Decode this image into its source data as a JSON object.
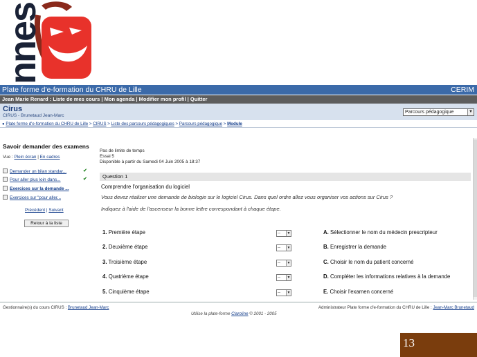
{
  "logo": {
    "text": "nnes"
  },
  "header": {
    "title": "Plate forme d'e-formation du CHRU de Lille",
    "brand": "CERIM"
  },
  "userbar": {
    "user": "Jean Marie Renard",
    "sep": " : ",
    "links": [
      "Liste de mes cours",
      "Mon agenda",
      "Modifier mon profil",
      "Quitter"
    ]
  },
  "course": {
    "title": "Cirus",
    "subtitle": "CIRUS - Brunetaud Jean-Marc",
    "select_value": "Parcours pédagogique"
  },
  "breadcrumb": {
    "items": [
      "Plate forme d'e-formation du CHRU de Lille",
      "CIRUS",
      "Liste des parcours pédagogiques",
      "Parcours pédagogique"
    ],
    "current": "Module"
  },
  "sidebar": {
    "title": "Savoir demander des examens",
    "view_label": "Vue :",
    "view_links": [
      "Plein écran",
      "En cadres"
    ],
    "items": [
      {
        "label": "Demander un bilan standar...",
        "checked": true,
        "bold": false
      },
      {
        "label": "Pour aller plus loin dans...",
        "checked": true,
        "bold": false
      },
      {
        "label": "Exercices sur la demande ...",
        "checked": false,
        "bold": true
      },
      {
        "label": "Exercices sur \"pour aller...",
        "checked": false,
        "bold": false
      }
    ],
    "prev": "Précédent",
    "next": "Suivant",
    "back_button": "Retour à la liste"
  },
  "exercise": {
    "time_limit": "Pas de limite de temps",
    "attempt": "Essai 5",
    "available": "Disponible à partir du Samedi 04 Juin 2005 à 18:37",
    "question_label": "Question 1",
    "question_title": "Comprendre l'organisation du logiciel",
    "question_text": "Vous devez réaliser une demande de biologie sur le logiciel Cirus. Dans quel ordre allez vous organiser vos actions sur Cirus ?",
    "instruction": "Indiquez à l'aide de l'ascenseur la bonne lettre correspondant à chaque étape.",
    "select_value": "--",
    "rows": [
      {
        "num": "1.",
        "step": "Première étape",
        "letter": "A.",
        "answer": "Sélectionner le nom du médecin prescripteur"
      },
      {
        "num": "2.",
        "step": "Deuxième étape",
        "letter": "B.",
        "answer": "Enregistrer la demande"
      },
      {
        "num": "3.",
        "step": "Troisième étape",
        "letter": "C.",
        "answer": "Choisir le nom du patient concerné"
      },
      {
        "num": "4.",
        "step": "Quatrième étape",
        "letter": "D.",
        "answer": "Compléter les informations relatives à la demande"
      },
      {
        "num": "5.",
        "step": "Cinquième étape",
        "letter": "E.",
        "answer": "Choisir l'examen concerné"
      }
    ]
  },
  "footer": {
    "left_label": "Gestionnaire(s) du cours CIRUS :",
    "left_link": "Brunetaud Jean-Marc",
    "right_label": "Administrateur Plate forme d'e-formation du CHRU de Lille :",
    "right_link": "Jean-Marc Brunetaud",
    "center_pre": "Utilise la plate-forme",
    "center_link": "Claroline",
    "center_post": "© 2001 - 2005"
  },
  "slide": {
    "number": "13"
  },
  "colors": {
    "header_blue": "#3b6aa9",
    "userbar_gray": "#5d5d5d",
    "course_bg": "#d7e1ee",
    "slide_brown": "#7a3d0d",
    "logo_red": "#e8322b"
  }
}
